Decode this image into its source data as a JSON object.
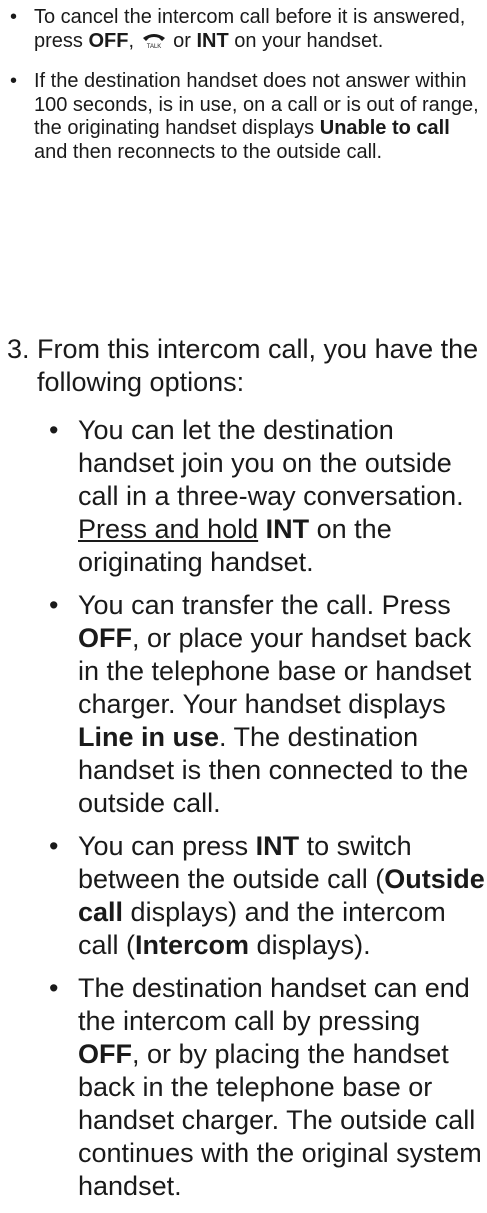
{
  "notes": [
    {
      "bullet": "•",
      "pre": "To cancel the intercom call before it is answered, press ",
      "off": "OFF",
      "comma": ", ",
      "talk_icon": "talk-phone-icon",
      "or": " or ",
      "int": "INT",
      "post": " on your handset."
    },
    {
      "bullet": "•",
      "pre": "If the destination handset does not answer within 100 seconds, is in use, on a call or is out of range, the originating handset displays ",
      "bold": "Unable to call",
      "post": " and then reconnects to the outside call."
    }
  ],
  "step3": {
    "number": "3.",
    "text": "From this intercom call, you have the following options:"
  },
  "options": [
    {
      "bullet": "•",
      "a": "You can let the destination handset join you on the outside call in a three-way conversation. ",
      "u": "Press and hold",
      "b": "INT",
      "c": " on the originating handset."
    },
    {
      "bullet": "•",
      "a": "You can transfer the call. Press ",
      "b1": "OFF",
      "c": ", or place your handset back in the telephone base or handset charger. Your handset displays ",
      "b2": "Line in use",
      "d": ". The destination handset is then connected to the outside call."
    },
    {
      "bullet": "•",
      "a": "You can press ",
      "b1": "INT",
      "c": " to switch between the outside call (",
      "b2": "Outside call",
      "d": " displays) and the intercom call (",
      "b3": "Intercom",
      "e": " displays)."
    },
    {
      "bullet": "•",
      "a": "The destination handset can end the intercom call by pressing ",
      "b": "OFF",
      "c": ", or by placing the handset back in the telephone base or handset charger. The outside call continues with the original system handset."
    }
  ]
}
